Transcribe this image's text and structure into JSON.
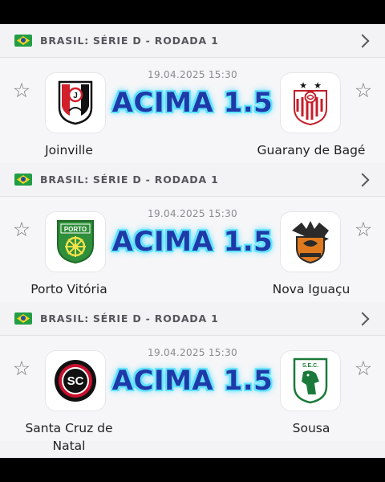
{
  "matches": [
    {
      "league": {
        "country": "BRASIL:",
        "name": "SÉRIE D - RODADA 1"
      },
      "datetime": "19.04.2025 15:30",
      "pick": "ACIMA 1.5",
      "home": {
        "name": "Joinville",
        "logo": "joinville-crest"
      },
      "away": {
        "name": "Guarany de Bagé",
        "logo": "guarany-crest"
      }
    },
    {
      "league": {
        "country": "BRASIL:",
        "name": "SÉRIE D - RODADA 1"
      },
      "datetime": "19.04.2025 15:30",
      "pick": "ACIMA 1.5",
      "home": {
        "name": "Porto Vitória",
        "logo": "porto-crest"
      },
      "away": {
        "name": "Nova Iguaçu",
        "logo": "nova-iguacu-crest"
      }
    },
    {
      "league": {
        "country": "BRASIL:",
        "name": "SÉRIE D - RODADA 1"
      },
      "datetime": "19.04.2025 15:30",
      "pick": "ACIMA 1.5",
      "home": {
        "name": "Santa Cruz de Natal",
        "logo": "santa-cruz-crest"
      },
      "away": {
        "name": "Sousa",
        "logo": "sousa-crest"
      }
    }
  ],
  "crest_text": {
    "porto": "PORTO",
    "santa_cruz": "SC",
    "sousa": "S.E.C."
  },
  "colors": {
    "pick_text": "#1d3aa8",
    "pick_glow": "#58e6ff",
    "joinville_red": "#d1202b",
    "porto_green": "#2f8f3a",
    "nova_orange": "#e07a1f"
  }
}
